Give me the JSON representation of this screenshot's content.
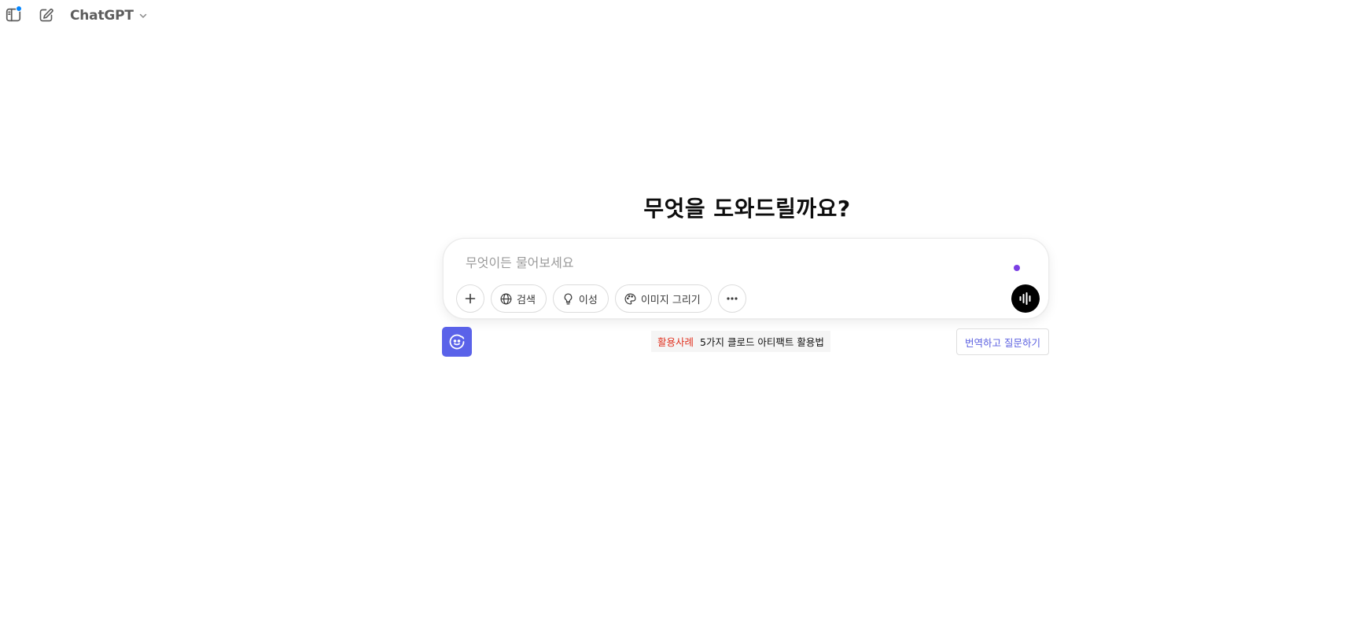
{
  "header": {
    "model_name": "ChatGPT",
    "icons": {
      "sidebar": "sidebar-toggle-icon",
      "new_chat": "compose-icon",
      "switcher": "chevron-down-icon"
    },
    "notification_color": "#0285ff"
  },
  "hero": {
    "title": "무엇을 도와드릴까요?"
  },
  "composer": {
    "placeholder": "무엇이든 물어보세요",
    "tools": [
      {
        "label": "",
        "icon": "plus-icon"
      },
      {
        "label": "검색",
        "icon": "globe-icon"
      },
      {
        "label": "이성",
        "icon": "lightbulb-icon"
      },
      {
        "label": "이미지 그리기",
        "icon": "palette-icon"
      },
      {
        "label": "",
        "icon": "more-horizontal-icon"
      }
    ],
    "voice_icon": "voice-waveform-icon",
    "typing_dot_color": "#7b3fe4"
  },
  "footer": {
    "extension_icon": "chat-bubble-icon",
    "extension_color": "#5a62e9",
    "tip_label": "활용사례",
    "tip_text": "5가지 클로드 아티팩트 활용법",
    "translate_label": "번역하고 질문하기"
  }
}
